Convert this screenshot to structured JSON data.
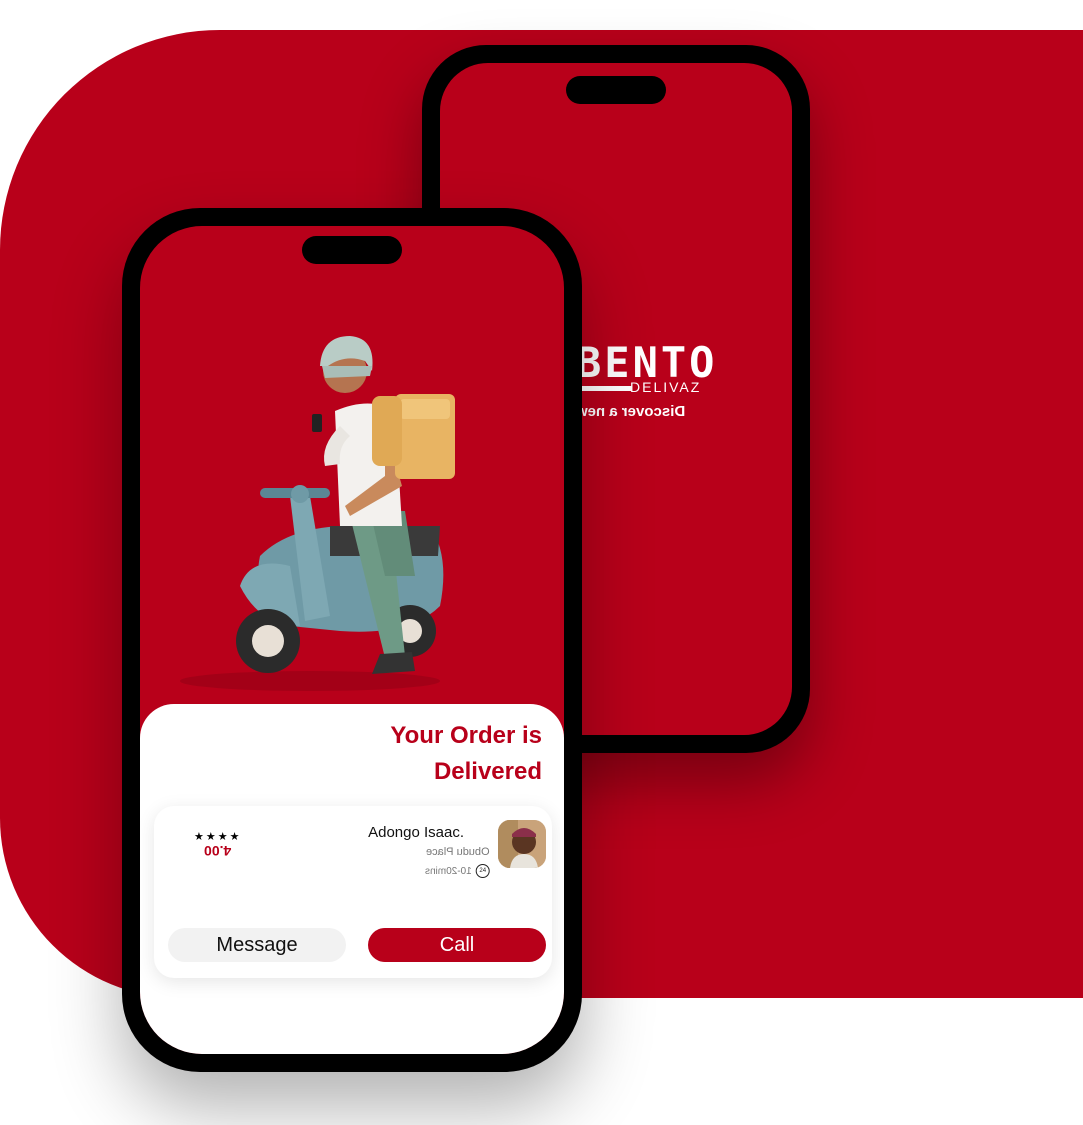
{
  "colors": {
    "brand_red": "#b8001a",
    "white": "#ffffff",
    "device_black": "#000000"
  },
  "splash_screen": {
    "logo_main": "BENTO",
    "logo_sub": "DELIVAZ",
    "tagline": "Discover a new"
  },
  "delivery_screen": {
    "illustration": "courier-on-scooter-illustration",
    "title": "Your Order is Delivered",
    "driver": {
      "name": "Adongo Isaac.",
      "place": "Obudu Place",
      "eta": "10-20mins",
      "rating": "4.00",
      "stars": "★★★★"
    },
    "buttons": {
      "message": "Message",
      "call": "Call"
    }
  }
}
